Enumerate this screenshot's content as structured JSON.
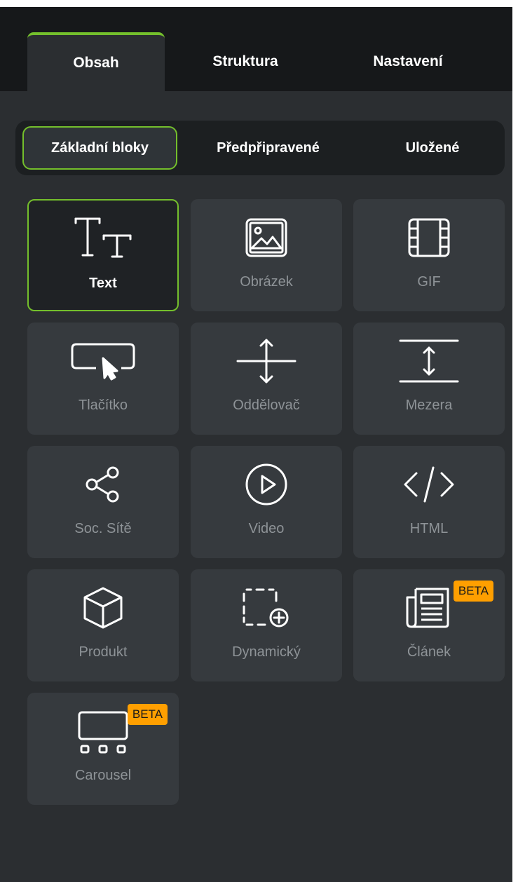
{
  "main_tabs": [
    {
      "label": "Obsah",
      "active": true
    },
    {
      "label": "Struktura",
      "active": false
    },
    {
      "label": "Nastavení",
      "active": false
    }
  ],
  "sub_tabs": [
    {
      "label": "Základní bloky",
      "active": true
    },
    {
      "label": "Předpřipravené",
      "active": false
    },
    {
      "label": "Uložené",
      "active": false
    }
  ],
  "blocks": [
    {
      "label": "Text",
      "icon": "text-size-icon",
      "selected": true
    },
    {
      "label": "Obrázek",
      "icon": "image-icon"
    },
    {
      "label": "GIF",
      "icon": "film-icon"
    },
    {
      "label": "Tlačítko",
      "icon": "button-cursor-icon"
    },
    {
      "label": "Oddělovač",
      "icon": "divider-icon"
    },
    {
      "label": "Mezera",
      "icon": "spacer-icon"
    },
    {
      "label": "Soc. Sítě",
      "icon": "share-icon"
    },
    {
      "label": "Video",
      "icon": "play-circle-icon"
    },
    {
      "label": "HTML",
      "icon": "code-icon"
    },
    {
      "label": "Produkt",
      "icon": "cube-icon"
    },
    {
      "label": "Dynamický",
      "icon": "dynamic-add-icon"
    },
    {
      "label": "Článek",
      "icon": "newspaper-icon",
      "badge": "BETA"
    },
    {
      "label": "Carousel",
      "icon": "carousel-icon",
      "badge": "BETA"
    }
  ],
  "colors": {
    "accent": "#74bf2c",
    "badge": "#ff9f00",
    "panel_bg": "#2b2e31",
    "tile_bg": "#363a3e"
  }
}
